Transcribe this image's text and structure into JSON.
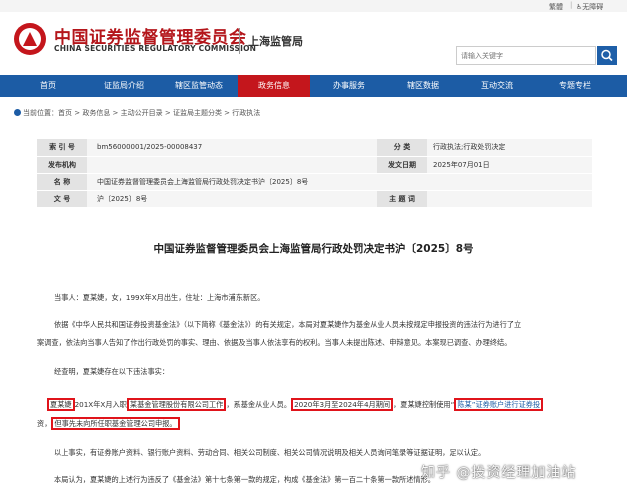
{
  "topbar": {
    "traditional": "繁體",
    "accessible": "无障碍"
  },
  "header": {
    "org_cn": "中国证券监督管理委员会",
    "org_en": "CHINA SECURITIES REGULATORY COMMISSION",
    "sub_org": "上海监管局",
    "search_placeholder": "请输入关键字"
  },
  "nav": {
    "items": [
      {
        "label": "首页"
      },
      {
        "label": "证监局介绍"
      },
      {
        "label": "辖区监管动态"
      },
      {
        "label": "政务信息"
      },
      {
        "label": "办事服务"
      },
      {
        "label": "辖区数据"
      },
      {
        "label": "互动交流"
      },
      {
        "label": "专题专栏"
      }
    ],
    "active_index": 3
  },
  "breadcrumb": {
    "label": "当前位置：",
    "path": "首页 > 政务信息 > 主动公开目录 > 证监局主题分类 > 行政执法"
  },
  "meta": {
    "index_key": "索 引 号",
    "index_val": "bm56000001/2025-00008437",
    "category_key": "分    类",
    "category_val": "行政执法;行政处罚决定",
    "issuer_key": "发布机构",
    "issuer_val": "",
    "date_key": "发文日期",
    "date_val": "2025年07月01日",
    "name_key": "名    称",
    "name_val": "中国证券监督管理委员会上海监管局行政处罚决定书沪〔2025〕8号",
    "docno_key": "文    号",
    "docno_val": "沪〔2025〕8号",
    "subject_key": "主 题 词",
    "subject_val": ""
  },
  "doc": {
    "title": "中国证券监督管理委员会上海监管局行政处罚决定书沪〔2025〕8号",
    "p1": "当事人：夏某婕，女，199X年X月出生，住址：上海市浦东新区。",
    "p2a": "依据《中华人民共和国证券投资基金法》（以下简称《基金法》）的有关规定，本局对夏某婕作为基金从业人员未按规定申报投资的违法行为进行了立",
    "p2b": "案调查，依法向当事人告知了作出行政处罚的事实、理由、依据及当事人依法享有的权利。当事人未提出陈述、申辩意见。本案现已调查、办理终结。",
    "p3": "经查明，夏某婕存在以下违法事实：",
    "p4_s1": "夏某婕",
    "p4_s2": "201X年X月入职",
    "p4_s3": "某基金管理股份有限公司工作",
    "p4_s4": "，系基金从业人员。",
    "p4_s5": "2020年3月至2024年4月期间",
    "p4_s6": "，夏某婕控制使用“",
    "p4_s7": "陈某”证券账户进行证券投",
    "p4b_s1": "资，",
    "p4b_s2": "但事先未向所任职基金管理公司申报。",
    "p5": "以上事实，有证券账户资料、银行账户资料、劳动合同、相关公司制度、相关公司情况说明及相关人员询问笔录等证据证明，足以认定。",
    "p6": "本局认为，夏某婕的上述行为违反了《基金法》第十七条第一款的规定，构成《基金法》第一百二十条第一款所述情形。"
  },
  "watermark": "知乎 @投资经理加油站",
  "colors": {
    "brand_red": "#c4161c",
    "nav_blue": "#1c5ca5",
    "highlight_red": "#e0141b"
  }
}
